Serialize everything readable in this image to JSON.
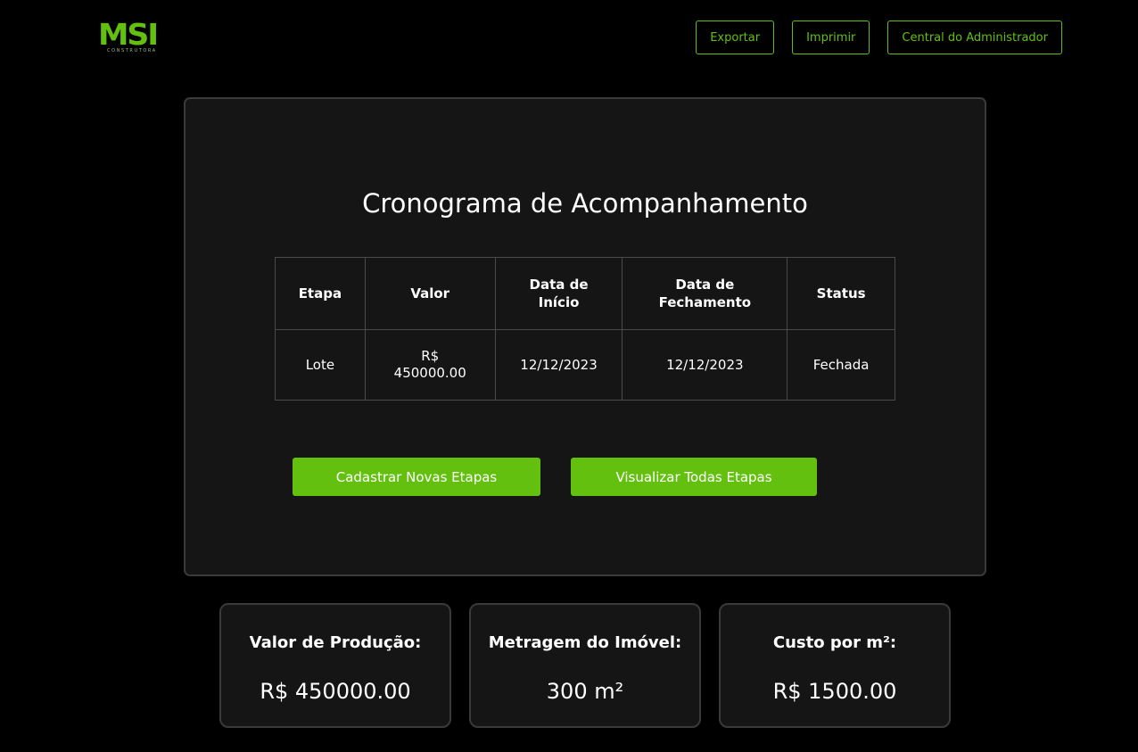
{
  "header": {
    "logo": {
      "mark": "MSI",
      "subtitle": "CONSTRUTORA"
    },
    "nav": [
      {
        "label": "Exportar"
      },
      {
        "label": "Imprimir"
      },
      {
        "label": "Central do Administrador"
      }
    ]
  },
  "schedule": {
    "title": "Cronograma de Acompanhamento",
    "columns": [
      "Etapa",
      "Valor",
      "Data de Início",
      "Data de Fechamento",
      "Status"
    ],
    "rows": [
      {
        "etapa": "Lote",
        "valor": "R$ 450000.00",
        "inicio": "12/12/2023",
        "fechamento": "12/12/2023",
        "status": "Fechada"
      }
    ],
    "actions": {
      "register": "Cadastrar Novas Etapas",
      "view_all": "Visualizar Todas Etapas"
    }
  },
  "stats": [
    {
      "label": "Valor de Produção:",
      "value": "R$ 450000.00"
    },
    {
      "label": "Metragem do Imóvel:",
      "value": "300 m²"
    },
    {
      "label": "Custo por m²:",
      "value": "R$ 1500.00"
    }
  ],
  "colors": {
    "accent": "#63c00f",
    "background": "#000000",
    "card": "#151515",
    "border": "#3a3a3a"
  }
}
